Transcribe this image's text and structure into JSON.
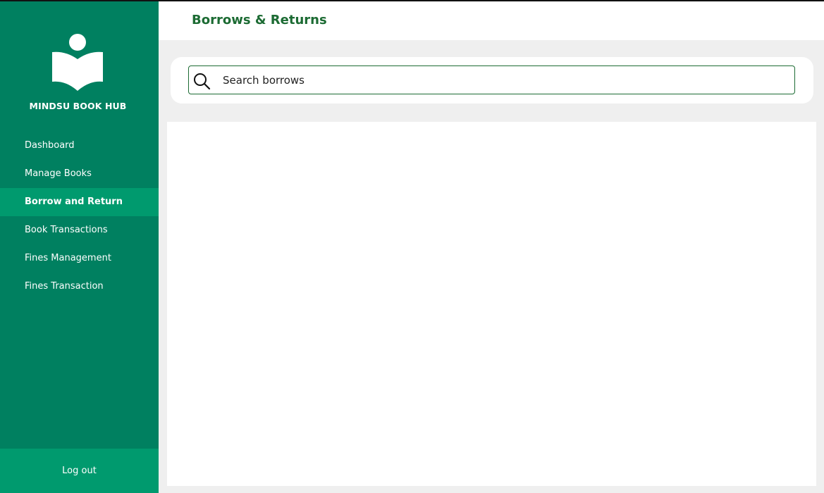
{
  "sidebar": {
    "brand": "MINDSU BOOK HUB",
    "logo_icon": "open-book-reader-icon",
    "items": [
      {
        "label": "Dashboard",
        "active": false
      },
      {
        "label": "Manage Books",
        "active": false
      },
      {
        "label": "Borrow and Return",
        "active": true
      },
      {
        "label": "Book Transactions",
        "active": false
      },
      {
        "label": "Fines Management",
        "active": false
      },
      {
        "label": "Fines Transaction",
        "active": false
      }
    ],
    "logout_label": "Log out"
  },
  "header": {
    "title": "Borrows & Returns"
  },
  "search": {
    "placeholder": "Search borrows",
    "value": "",
    "icon": "search-icon"
  },
  "colors": {
    "sidebar_bg": "#008060",
    "sidebar_active": "#009a6e",
    "title_green": "#1c6b33",
    "page_bg": "#efefef"
  }
}
